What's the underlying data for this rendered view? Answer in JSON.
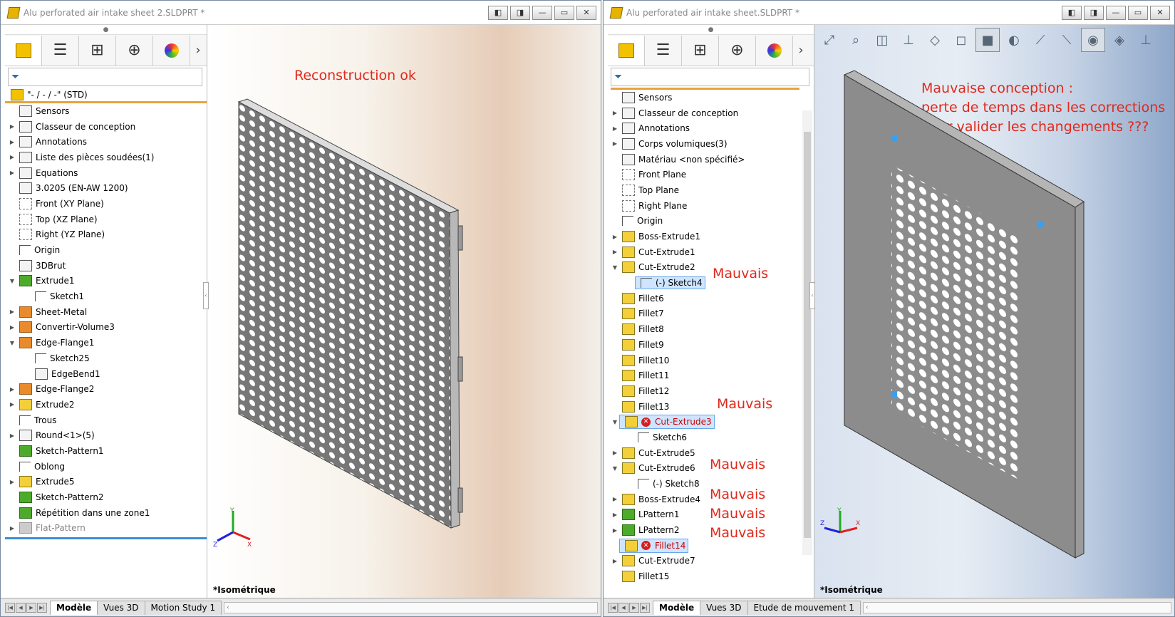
{
  "left": {
    "title": "Alu perforated air intake sheet 2.SLDPRT *",
    "root": "\"- / - / -\"  (STD)",
    "tree": [
      {
        "label": "Sensors",
        "exp": "",
        "icon": "sensor-icon",
        "cls": "box",
        "indent": 0
      },
      {
        "label": "Classeur de conception",
        "exp": "▶",
        "icon": "folder-icon",
        "cls": "box",
        "indent": 0
      },
      {
        "label": "Annotations",
        "exp": "▶",
        "icon": "annotation-icon",
        "cls": "box",
        "indent": 0
      },
      {
        "label": "Liste des pièces soudées(1)",
        "exp": "▶",
        "icon": "cutlist-icon",
        "cls": "box",
        "indent": 0
      },
      {
        "label": "Equations",
        "exp": "▶",
        "icon": "sigma-icon",
        "cls": "box",
        "indent": 0
      },
      {
        "label": "3.0205 (EN-AW 1200)",
        "exp": "",
        "icon": "material-icon",
        "cls": "box",
        "indent": 0
      },
      {
        "label": "Front (XY Plane)",
        "exp": "",
        "icon": "plane-icon",
        "cls": "plane",
        "indent": 0
      },
      {
        "label": "Top (XZ Plane)",
        "exp": "",
        "icon": "plane-icon",
        "cls": "plane",
        "indent": 0
      },
      {
        "label": "Right (YZ Plane)",
        "exp": "",
        "icon": "plane-icon",
        "cls": "plane",
        "indent": 0
      },
      {
        "label": "Origin",
        "exp": "",
        "icon": "origin-icon",
        "cls": "sketch",
        "indent": 0
      },
      {
        "label": "3DBrut",
        "exp": "",
        "icon": "3d-sketch-icon",
        "cls": "box",
        "indent": 0
      },
      {
        "label": "Extrude1",
        "exp": "▼",
        "icon": "extrude-icon",
        "cls": "green",
        "indent": 0
      },
      {
        "label": "Sketch1",
        "exp": "",
        "icon": "sketch-icon",
        "cls": "sketch",
        "indent": 1
      },
      {
        "label": "Sheet-Metal",
        "exp": "▶",
        "icon": "sheet-metal-icon",
        "cls": "orange",
        "indent": 0
      },
      {
        "label": "Convertir-Volume3",
        "exp": "▶",
        "icon": "convert-icon",
        "cls": "orange",
        "indent": 0
      },
      {
        "label": "Edge-Flange1",
        "exp": "▼",
        "icon": "edge-flange-icon",
        "cls": "orange",
        "indent": 0
      },
      {
        "label": "Sketch25",
        "exp": "",
        "icon": "sketch-icon",
        "cls": "sketch",
        "indent": 1
      },
      {
        "label": "EdgeBend1",
        "exp": "",
        "icon": "edge-bend-icon",
        "cls": "box",
        "indent": 1
      },
      {
        "label": "Edge-Flange2",
        "exp": "▶",
        "icon": "edge-flange-icon",
        "cls": "orange",
        "indent": 0
      },
      {
        "label": "Extrude2",
        "exp": "▶",
        "icon": "extrude-icon",
        "cls": "feat",
        "indent": 0
      },
      {
        "label": "Trous",
        "exp": "",
        "icon": "sketch-icon",
        "cls": "sketch",
        "indent": 0
      },
      {
        "label": "Round<1>(5)",
        "exp": "▶",
        "icon": "library-feature-icon",
        "cls": "box",
        "indent": 0
      },
      {
        "label": "Sketch-Pattern1",
        "exp": "",
        "icon": "sketch-pattern-icon",
        "cls": "green",
        "indent": 0
      },
      {
        "label": "Oblong",
        "exp": "",
        "icon": "sketch-icon",
        "cls": "sketch",
        "indent": 0
      },
      {
        "label": "Extrude5",
        "exp": "▶",
        "icon": "extrude-icon",
        "cls": "feat",
        "indent": 0
      },
      {
        "label": "Sketch-Pattern2",
        "exp": "",
        "icon": "sketch-pattern-icon",
        "cls": "green",
        "indent": 0
      },
      {
        "label": "Répétition dans une zone1",
        "exp": "",
        "icon": "fill-pattern-icon",
        "cls": "green",
        "indent": 0
      },
      {
        "label": "Flat-Pattern",
        "exp": "▶",
        "icon": "flat-pattern-icon",
        "cls": "gray",
        "indent": 0,
        "dim": true
      }
    ],
    "annotation": "Reconstruction ok",
    "view_label": "*Isométrique",
    "tabs": [
      "Modèle",
      "Vues 3D",
      "Motion Study 1"
    ]
  },
  "right": {
    "title": "Alu perforated air intake sheet.SLDPRT *",
    "tree": [
      {
        "label": "Sensors",
        "exp": "",
        "icon": "sensor-icon",
        "cls": "box",
        "indent": 0
      },
      {
        "label": "Classeur de conception",
        "exp": "▶",
        "icon": "folder-icon",
        "cls": "box",
        "indent": 0
      },
      {
        "label": "Annotations",
        "exp": "▶",
        "icon": "annotation-icon",
        "cls": "box",
        "indent": 0
      },
      {
        "label": "Corps volumiques(3)",
        "exp": "▶",
        "icon": "solid-bodies-icon",
        "cls": "box",
        "indent": 0
      },
      {
        "label": "Matériau <non spécifié>",
        "exp": "",
        "icon": "material-icon",
        "cls": "box",
        "indent": 0
      },
      {
        "label": "Front Plane",
        "exp": "",
        "icon": "plane-icon",
        "cls": "plane",
        "indent": 0
      },
      {
        "label": "Top Plane",
        "exp": "",
        "icon": "plane-icon",
        "cls": "plane",
        "indent": 0
      },
      {
        "label": "Right Plane",
        "exp": "",
        "icon": "plane-icon",
        "cls": "plane",
        "indent": 0
      },
      {
        "label": "Origin",
        "exp": "",
        "icon": "origin-icon",
        "cls": "sketch",
        "indent": 0
      },
      {
        "label": "Boss-Extrude1",
        "exp": "▶",
        "icon": "extrude-icon",
        "cls": "feat",
        "indent": 0
      },
      {
        "label": "Cut-Extrude1",
        "exp": "▶",
        "icon": "extrude-icon",
        "cls": "feat",
        "indent": 0
      },
      {
        "label": "Cut-Extrude2",
        "exp": "▼",
        "icon": "extrude-icon",
        "cls": "feat",
        "indent": 0
      },
      {
        "label": "(-) Sketch4",
        "exp": "",
        "icon": "sketch-icon",
        "cls": "sketch",
        "indent": 1,
        "sel": true
      },
      {
        "label": "Fillet6",
        "exp": "",
        "icon": "fillet-icon",
        "cls": "feat",
        "indent": 0
      },
      {
        "label": "Fillet7",
        "exp": "",
        "icon": "fillet-icon",
        "cls": "feat",
        "indent": 0
      },
      {
        "label": "Fillet8",
        "exp": "",
        "icon": "fillet-icon",
        "cls": "feat",
        "indent": 0
      },
      {
        "label": "Fillet9",
        "exp": "",
        "icon": "fillet-icon",
        "cls": "feat",
        "indent": 0
      },
      {
        "label": "Fillet10",
        "exp": "",
        "icon": "fillet-icon",
        "cls": "feat",
        "indent": 0
      },
      {
        "label": "Fillet11",
        "exp": "",
        "icon": "fillet-icon",
        "cls": "feat",
        "indent": 0
      },
      {
        "label": "Fillet12",
        "exp": "",
        "icon": "fillet-icon",
        "cls": "feat",
        "indent": 0
      },
      {
        "label": "Fillet13",
        "exp": "",
        "icon": "fillet-icon",
        "cls": "feat",
        "indent": 0
      },
      {
        "label": "Cut-Extrude3",
        "exp": "▼",
        "icon": "extrude-icon",
        "cls": "feat",
        "indent": 0,
        "error": true,
        "sel": true
      },
      {
        "label": "Sketch6",
        "exp": "",
        "icon": "sketch-icon",
        "cls": "sketch",
        "indent": 1
      },
      {
        "label": "Cut-Extrude5",
        "exp": "▶",
        "icon": "extrude-icon",
        "cls": "feat",
        "indent": 0
      },
      {
        "label": "Cut-Extrude6",
        "exp": "▼",
        "icon": "extrude-icon",
        "cls": "feat",
        "indent": 0
      },
      {
        "label": "(-) Sketch8",
        "exp": "",
        "icon": "sketch-icon",
        "cls": "sketch",
        "indent": 1
      },
      {
        "label": "Boss-Extrude4",
        "exp": "▶",
        "icon": "extrude-icon",
        "cls": "feat",
        "indent": 0
      },
      {
        "label": "LPattern1",
        "exp": "▶",
        "icon": "linear-pattern-icon",
        "cls": "green",
        "indent": 0
      },
      {
        "label": "LPattern2",
        "exp": "▶",
        "icon": "linear-pattern-icon",
        "cls": "green",
        "indent": 0
      },
      {
        "label": "Fillet14",
        "exp": "",
        "icon": "fillet-icon",
        "cls": "feat",
        "indent": 0,
        "error": true,
        "sel": true
      },
      {
        "label": "Cut-Extrude7",
        "exp": "▶",
        "icon": "extrude-icon",
        "cls": "feat",
        "indent": 0
      },
      {
        "label": "Fillet15",
        "exp": "",
        "icon": "fillet-icon",
        "cls": "feat",
        "indent": 0
      }
    ],
    "annotation_lines": [
      "Mauvaise conception :",
      "perte de temps dans les corrections",
      "pour valider les changements ???"
    ],
    "mauvais": "Mauvais",
    "view_label": "*Isométrique",
    "tabs": [
      "Modèle",
      "Vues 3D",
      "Etude de mouvement 1"
    ]
  },
  "window_buttons": [
    "◧",
    "◨",
    "—",
    "▭",
    "✕"
  ],
  "fm_tabs": [
    "feature-manager-icon",
    "property-manager-icon",
    "configuration-manager-icon",
    "dimxpert-icon",
    "display-manager-icon"
  ],
  "colors": {
    "annotation": "#e0291c",
    "accent": "#3a8fd6",
    "selection": "#cfe5ff"
  }
}
